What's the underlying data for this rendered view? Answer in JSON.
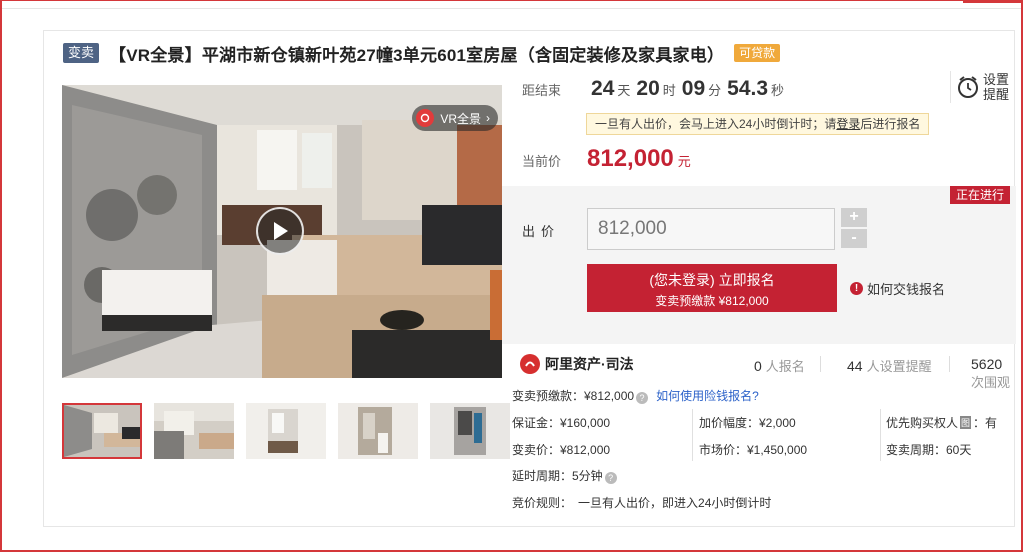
{
  "listing": {
    "tag": "变卖",
    "title": "【VR全景】平湖市新仓镇新叶苑27幢3单元601室房屋（含固定装修及家具家电）",
    "loan_tag": "可贷款"
  },
  "media": {
    "vr_badge": "VR全景",
    "thumbnails_count": 5
  },
  "countdown": {
    "label": "距结束",
    "days": "24",
    "days_unit": "天",
    "hours": "20",
    "hours_unit": "时",
    "minutes": "09",
    "minutes_unit": "分",
    "seconds": "54.3",
    "seconds_unit": "秒"
  },
  "reminder": {
    "label_line1": "设置",
    "label_line2": "提醒"
  },
  "notice": {
    "text_before": "一旦有人出价，会马上进入24小时倒计时；请",
    "link": "登录",
    "text_after": "后进行报名"
  },
  "price": {
    "label": "当前价",
    "value": "812,000",
    "unit": "元"
  },
  "bid": {
    "status": "正在进行",
    "label": "出价",
    "input_value": "812,000",
    "plus": "+",
    "minus": "-",
    "signup_line1": "(您未登录) 立即报名",
    "signup_line2": "变卖预缴款 ¥812,000",
    "how_pay": "如何交钱报名"
  },
  "stats": {
    "brand": "阿里资产·司法",
    "signups_num": "0",
    "signups_label": "人报名",
    "reminders_num": "44",
    "reminders_label": "人设置提醒",
    "views_num": "5620",
    "views_label": "次围观"
  },
  "details": {
    "prepay": "变卖预缴款：¥812,000",
    "insurance_link": "如何使用险钱报名?",
    "deposit": "保证金：¥160,000",
    "increment": "加价幅度：¥2,000",
    "priority_a": "优先购买权人",
    "priority_icon": "图",
    "priority_b": "：有",
    "sale_price": "变卖价：¥812,000",
    "market_price": "市场价：¥1,450,000",
    "sale_period": "变卖周期：60天",
    "delay": "延时周期：5分钟",
    "rule_label": "竞价规则：",
    "rule_text": "一旦有人出价，即进入24小时倒计时"
  },
  "colors": {
    "brand_red": "#c42233",
    "tag_blue": "#4e6384",
    "loan_orange": "#f0a93b"
  }
}
